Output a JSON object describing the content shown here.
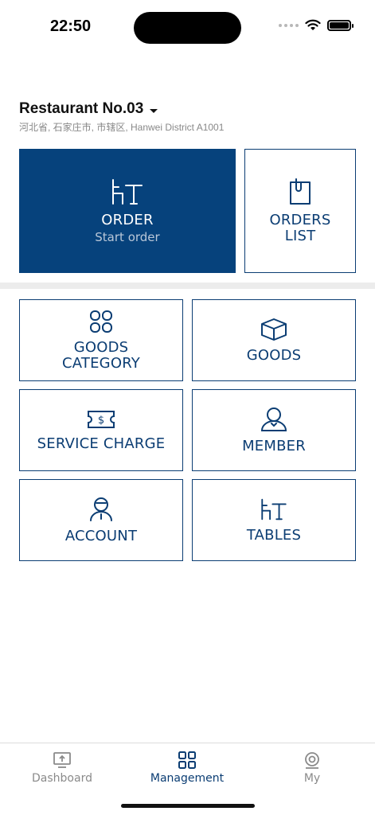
{
  "status_bar": {
    "time": "22:50"
  },
  "restaurant": {
    "name": "Restaurant No.03",
    "address": "河北省, 石家庄市, 市辖区, Hanwei District A1001"
  },
  "tiles": {
    "order": {
      "label": "ORDER",
      "sublabel": "Start order",
      "icon": "table-chair-icon"
    },
    "orders_list": {
      "line1": "ORDERS",
      "line2": "LIST",
      "icon": "clipboard-icon"
    },
    "goods_category": {
      "line1": "GOODS",
      "line2": "CATEGORY",
      "icon": "grid-category-icon"
    },
    "goods": {
      "label": "GOODS",
      "icon": "box-icon"
    },
    "service_charge": {
      "label": "SERVICE CHARGE",
      "icon": "ticket-dollar-icon"
    },
    "member": {
      "label": "MEMBER",
      "icon": "member-person-icon"
    },
    "account": {
      "label": "ACCOUNT",
      "icon": "account-person-icon"
    },
    "tables": {
      "label": "TABLES",
      "icon": "table-chair-icon"
    }
  },
  "tabbar": {
    "tabs": [
      {
        "label": "Dashboard",
        "icon": "monitor-icon"
      },
      {
        "label": "Management",
        "icon": "grid-icon"
      },
      {
        "label": "My",
        "icon": "user-circle-icon"
      }
    ],
    "active": "Management"
  },
  "colors": {
    "primary": "#06427c",
    "text": "#0b3d73",
    "inactive": "#8a8a8a"
  }
}
